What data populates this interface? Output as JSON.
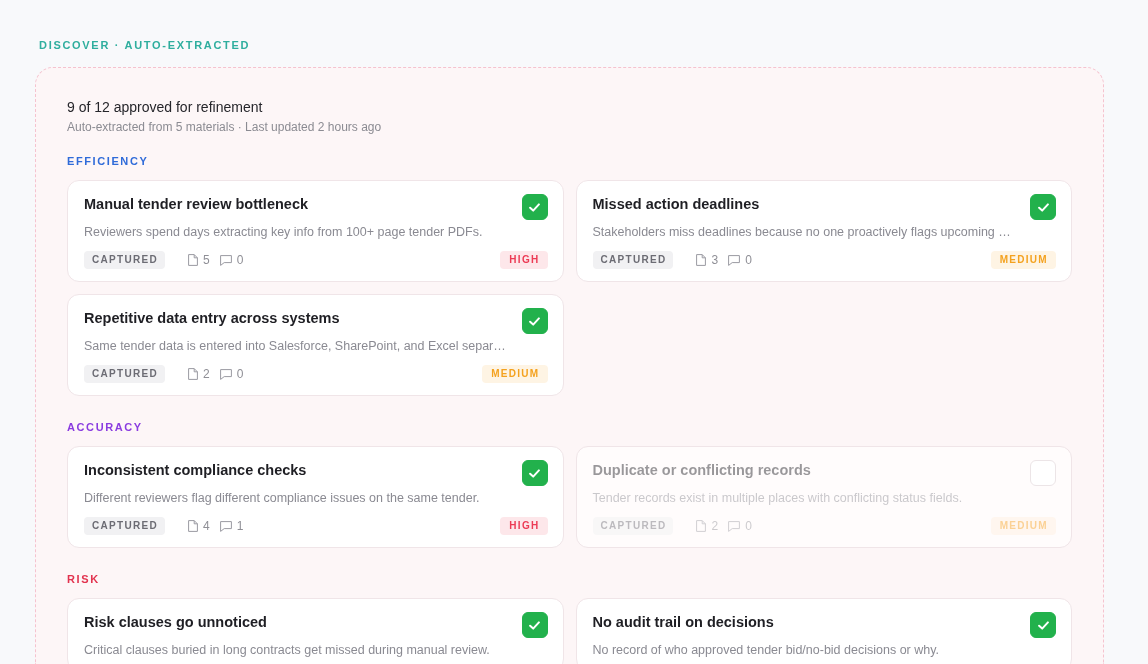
{
  "eyebrow": "DISCOVER · AUTO-EXTRACTED",
  "summary": {
    "title": "9 of 12 approved for refinement",
    "subtitle": "Auto-extracted from 5 materials · Last updated 2 hours ago"
  },
  "groups": [
    {
      "label": "EFFICIENCY",
      "color": "#2f6bd9",
      "items": [
        {
          "title": "Manual tender review bottleneck",
          "description": "Reviewers spend days extracting key info from 100+ page tender PDFs.",
          "checked": true,
          "footer": {
            "status": "CAPTURED",
            "documents": "5",
            "comments": "0",
            "priority": {
              "label": "HIGH",
              "color": "#ec3b55"
            }
          }
        },
        {
          "title": "Missed action deadlines",
          "description": "Stakeholders miss deadlines because no one proactively flags upcoming …",
          "checked": true,
          "footer": {
            "status": "CAPTURED",
            "documents": "3",
            "comments": "0",
            "priority": {
              "label": "MEDIUM",
              "color": "#f4a21f"
            }
          }
        },
        {
          "title": "Repetitive data entry across systems",
          "description": "Same tender data is entered into Salesforce, SharePoint, and Excel separ…",
          "checked": true,
          "footer": {
            "status": "CAPTURED",
            "documents": "2",
            "comments": "0",
            "priority": {
              "label": "MEDIUM",
              "color": "#f4a21f"
            }
          }
        }
      ]
    },
    {
      "label": "ACCURACY",
      "color": "#8a3ce0",
      "items": [
        {
          "title": "Inconsistent compliance checks",
          "description": "Different reviewers flag different compliance issues on the same tender.",
          "checked": true,
          "footer": {
            "status": "CAPTURED",
            "documents": "4",
            "comments": "1",
            "priority": {
              "label": "HIGH",
              "color": "#ec3b55"
            }
          }
        },
        {
          "title": "Duplicate or conflicting records",
          "description": "Tender records exist in multiple places with conflicting status fields.",
          "checked": false,
          "footer": {
            "status": "CAPTURED",
            "documents": "2",
            "comments": "0",
            "priority": {
              "label": "MEDIUM",
              "color": "#fbd195"
            }
          }
        }
      ]
    },
    {
      "label": "RISK",
      "color": "#e2334f",
      "items": [
        {
          "title": "Risk clauses go unnoticed",
          "description": "Critical clauses buried in long contracts get missed during manual review.",
          "checked": true
        },
        {
          "title": "No audit trail on decisions",
          "description": "No record of who approved tender bid/no-bid decisions or why.",
          "checked": true
        }
      ]
    }
  ]
}
